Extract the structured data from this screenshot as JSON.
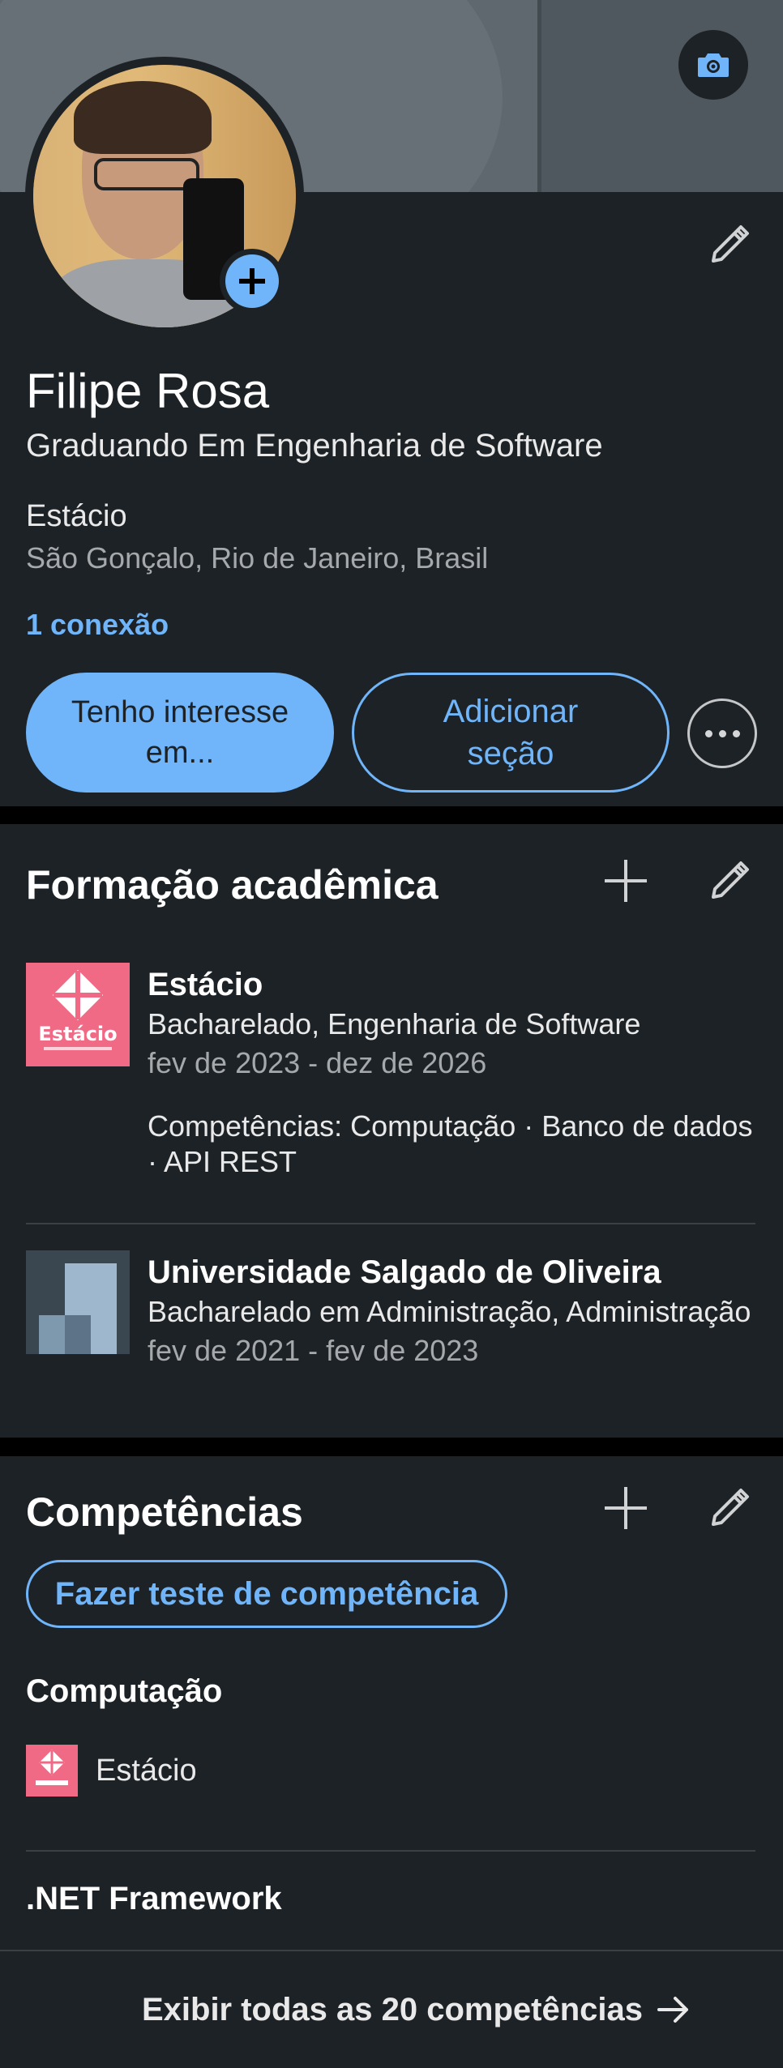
{
  "profile": {
    "name": "Filipe Rosa",
    "headline": "Graduando Em Engenharia de Software",
    "organization": "Estácio",
    "location": "São Gonçalo, Rio de Janeiro, Brasil",
    "connections": "1 conexão",
    "buttons": {
      "open_to": "Tenho interesse em...",
      "add_section": "Adicionar seção"
    }
  },
  "education": {
    "title": "Formação acadêmica",
    "items": [
      {
        "school": "Estácio",
        "degree": "Bacharelado, Engenharia de Software",
        "dates": "fev de 2023 - dez de 2026",
        "skills": "Competências: Computação · Banco de dados · API REST",
        "logo_text": "Estácio"
      },
      {
        "school": "Universidade Salgado de Oliveira",
        "degree": "Bacharelado em Administração, Administração",
        "dates": "fev de 2021 - fev de 2023"
      }
    ]
  },
  "skills": {
    "title": "Competências",
    "test_button": "Fazer teste de competência",
    "items": [
      {
        "name": "Computação",
        "source": "Estácio"
      },
      {
        "name": ".NET Framework"
      }
    ],
    "show_all": "Exibir todas as 20 competências"
  },
  "colors": {
    "accent": "#70b5f9",
    "card_bg": "#1d2226",
    "page_bg": "#000000",
    "estacio_brand": "#f06a85"
  },
  "icons": [
    "camera-icon",
    "plus-icon",
    "pencil-icon",
    "more-icon",
    "arrow-right-icon"
  ]
}
